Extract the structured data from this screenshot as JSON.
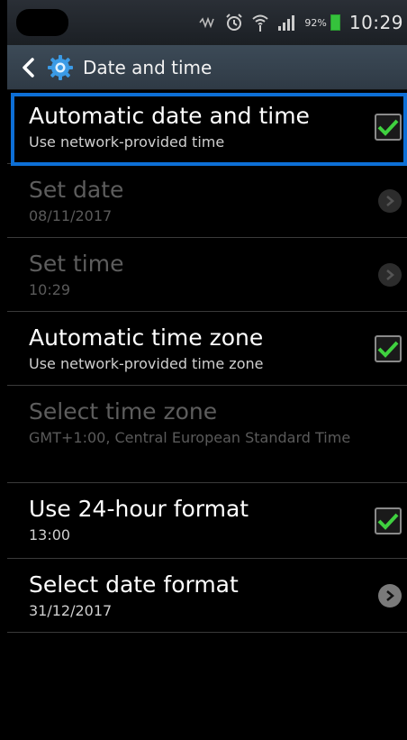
{
  "status_bar": {
    "battery_percent": "92%",
    "time": "10:29",
    "icons": [
      "vibrate-icon",
      "alarm-icon",
      "wifi-icon",
      "signal-icon",
      "battery-icon"
    ]
  },
  "action_bar": {
    "title": "Date and time",
    "icons": [
      "back-chevron-icon",
      "settings-gear-icon"
    ]
  },
  "settings": [
    {
      "label": "Automatic date and time",
      "summary": "Use network-provided time",
      "control": "checkbox",
      "checked": true,
      "enabled": true
    },
    {
      "label": "Set date",
      "summary": "08/11/2017",
      "control": "arrow",
      "enabled": false
    },
    {
      "label": "Set time",
      "summary": "10:29",
      "control": "arrow",
      "enabled": false
    },
    {
      "label": "Automatic time zone",
      "summary": "Use network-provided time zone",
      "control": "checkbox",
      "checked": true,
      "enabled": true
    },
    {
      "label": "Select time zone",
      "summary": "GMT+1:00, Central European Standard Time",
      "control": "none",
      "enabled": false
    },
    {
      "label": "Use 24-hour format",
      "summary": "13:00",
      "control": "checkbox",
      "checked": true,
      "enabled": true
    },
    {
      "label": "Select date format",
      "summary": "31/12/2017",
      "control": "arrow",
      "enabled": true
    }
  ],
  "colors": {
    "highlight": "#0d6fd6",
    "check": "#3fd13f",
    "actionbar": "#34404c"
  }
}
